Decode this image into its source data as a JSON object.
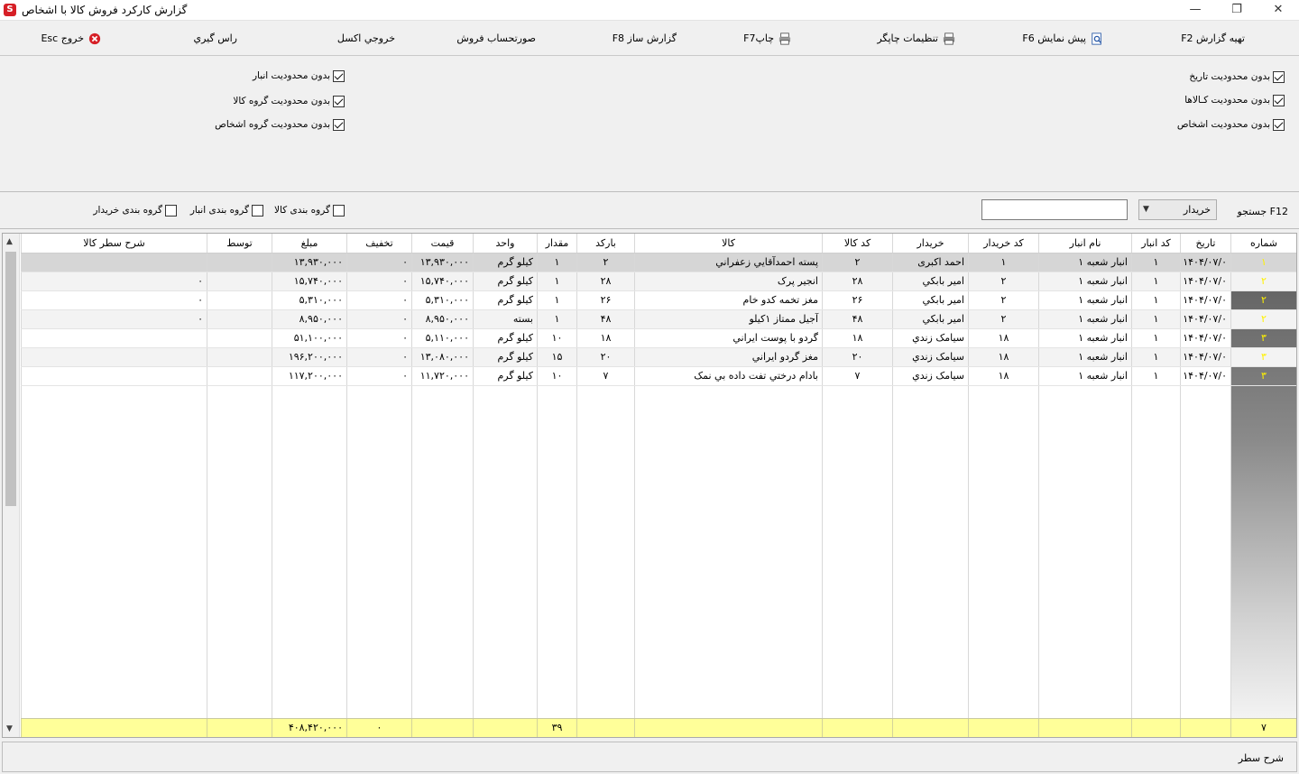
{
  "window": {
    "title": "گزارش کارکرد فروش کالا با اشخاص",
    "logo": "S",
    "minimize_icon": "—",
    "restore_icon": "❐",
    "close_icon": "✕"
  },
  "toolbar": {
    "prepare": "تهيه گزارش  F2",
    "preview": "پيش نمايش F6",
    "printer_settings": "تنظيمات چاپگر",
    "print": "چاپF7",
    "report_builder": "گزارش ساز F8",
    "invoice": "صورتحساب فروش",
    "excel": "خروجي اکسل",
    "rounding": "راس گيري",
    "exit": "خروج Esc"
  },
  "filters": {
    "right": [
      {
        "label": "بدون محدوديت تاريخ",
        "checked": true
      },
      {
        "label": "بدون محدوديت کـالاها",
        "checked": true
      },
      {
        "label": "بدون محدوديت اشخاص",
        "checked": true
      }
    ],
    "left": [
      {
        "label": "بدون محدوديت انبار",
        "checked": true
      },
      {
        "label": "بدون محدوديت گروه کالا",
        "checked": true
      },
      {
        "label": "بدون محدوديت گروه اشخاص",
        "checked": true
      }
    ]
  },
  "search": {
    "label": "جستجو F12",
    "field_selected": "خريدار",
    "value": "",
    "group_goods": "گروه بندی کالا",
    "group_warehouse": "گروه بندی انبار",
    "group_buyer": "گروه بندی خريدار"
  },
  "grid": {
    "columns": [
      "شماره",
      "تاريخ",
      "کد انبار",
      "نام انبار",
      "کد خريدار",
      "خريدار",
      "کد کالا",
      "کالا",
      "بارکد",
      "مقدار",
      "واحد",
      "قيمت",
      "تخفيف",
      "مبلغ",
      "توسط",
      "شرح سطر کالا"
    ],
    "rows": [
      [
        "۱",
        "۱۴۰۴/۰۷/۰",
        "۱",
        "انبار شعبه ۱",
        "۱",
        "احمد اکبری",
        "۲",
        "پسته احمدآقايي زعفراني",
        "۲",
        "۱",
        "کيلو گرم",
        "۱۳,۹۳۰,۰۰۰",
        "۰",
        "۱۳,۹۳۰,۰۰۰",
        "",
        ""
      ],
      [
        "۲",
        "۱۴۰۴/۰۷/۰",
        "۱",
        "انبار شعبه ۱",
        "۲",
        "امير  بابکي",
        "۲۸",
        "انجير پرک",
        "۲۸",
        "۱",
        "کيلو گرم",
        "۱۵,۷۴۰,۰۰۰",
        "۰",
        "۱۵,۷۴۰,۰۰۰",
        "",
        "۰"
      ],
      [
        "۲",
        "۱۴۰۴/۰۷/۰",
        "۱",
        "انبار شعبه ۱",
        "۲",
        "امير  بابکي",
        "۲۶",
        "مغز تخمه کدو خام",
        "۲۶",
        "۱",
        "کيلو گرم",
        "۵,۳۱۰,۰۰۰",
        "۰",
        "۵,۳۱۰,۰۰۰",
        "",
        "۰"
      ],
      [
        "۲",
        "۱۴۰۴/۰۷/۰",
        "۱",
        "انبار شعبه ۱",
        "۲",
        "امير  بابکي",
        "۴۸",
        "آجيل ممتاز ۱کيلو",
        "۴۸",
        "۱",
        "بسته",
        "۸,۹۵۰,۰۰۰",
        "۰",
        "۸,۹۵۰,۰۰۰",
        "",
        "۰"
      ],
      [
        "۳",
        "۱۴۰۴/۰۷/۰",
        "۱",
        "انبار شعبه ۱",
        "۱۸",
        "سيامک زندي",
        "۱۸",
        "گردو با پوست ايراني",
        "۱۸",
        "۱۰",
        "کيلو گرم",
        "۵,۱۱۰,۰۰۰",
        "۰",
        "۵۱,۱۰۰,۰۰۰",
        "",
        ""
      ],
      [
        "۳",
        "۱۴۰۴/۰۷/۰",
        "۱",
        "انبار شعبه ۱",
        "۱۸",
        "سيامک زندي",
        "۲۰",
        "مغز گردو ايراني",
        "۲۰",
        "۱۵",
        "کيلو گرم",
        "۱۳,۰۸۰,۰۰۰",
        "۰",
        "۱۹۶,۲۰۰,۰۰۰",
        "",
        ""
      ],
      [
        "۳",
        "۱۴۰۴/۰۷/۰",
        "۱",
        "انبار شعبه ۱",
        "۱۸",
        "سيامک زندي",
        "۷",
        "بادام درختي تفت داده بي نمک",
        "۷",
        "۱۰",
        "کيلو گرم",
        "۱۱,۷۲۰,۰۰۰",
        "۰",
        "۱۱۷,۲۰۰,۰۰۰",
        "",
        ""
      ]
    ],
    "footer": {
      "count": "۷",
      "quantity_total": "۳۹",
      "discount_total": "۰",
      "amount_total": "۴۰۸,۴۲۰,۰۰۰"
    },
    "scroll_up": "▲",
    "scroll_down": "▼"
  },
  "bottom": {
    "label": "شرح سطر"
  },
  "colors": {
    "row_number_text": "#fff200",
    "footer_bg": "#ffff99",
    "exit_icon": "#d61f26"
  }
}
